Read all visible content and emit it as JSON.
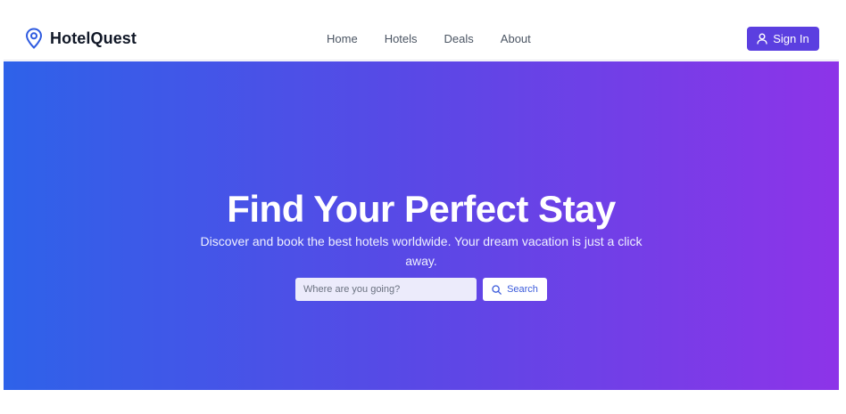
{
  "brand": {
    "name": "HotelQuest",
    "icon": "map-pin-icon",
    "color": "#2f5be0"
  },
  "nav": {
    "items": [
      {
        "label": "Home"
      },
      {
        "label": "Hotels"
      },
      {
        "label": "Deals"
      },
      {
        "label": "About"
      }
    ]
  },
  "header": {
    "signin_label": "Sign In",
    "signin_icon": "user-icon",
    "signin_color": "#5b3fe0"
  },
  "hero": {
    "title": "Find Your Perfect Stay",
    "subtitle": "Discover and book the best hotels worldwide. Your dream vacation is just a click away.",
    "gradient_start": "#2e62e9",
    "gradient_end": "#8d34e8"
  },
  "search": {
    "placeholder": "Where are you going?",
    "value": "",
    "button_label": "Search",
    "button_icon": "search-icon"
  }
}
